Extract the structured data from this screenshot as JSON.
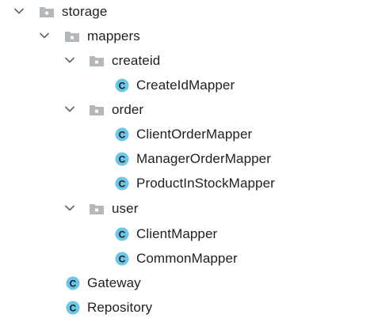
{
  "tree": {
    "storage": {
      "label": "storage",
      "expanded": true,
      "icon": "package-folder-icon",
      "mappers": {
        "label": "mappers",
        "expanded": true,
        "icon": "package-folder-icon",
        "createid": {
          "label": "createid",
          "expanded": true,
          "icon": "package-folder-icon",
          "classes": [
            "CreateIdMapper"
          ]
        },
        "order": {
          "label": "order",
          "expanded": true,
          "icon": "package-folder-icon",
          "classes": [
            "ClientOrderMapper",
            "ManagerOrderMapper",
            "ProductInStockMapper"
          ]
        },
        "user": {
          "label": "user",
          "expanded": true,
          "icon": "package-folder-icon",
          "classes": [
            "ClientMapper",
            "CommonMapper"
          ]
        }
      },
      "classes": [
        "Gateway",
        "Repository"
      ]
    }
  },
  "icons": {
    "class_badge_letter": "C",
    "class_badge_color": "#6bc6e8",
    "class_badge_text_color": "#1a1a1a",
    "folder_color": "#b3b8bd",
    "folder_dot_color": "#ffffff",
    "chevron_color": "#6a6a6a"
  }
}
